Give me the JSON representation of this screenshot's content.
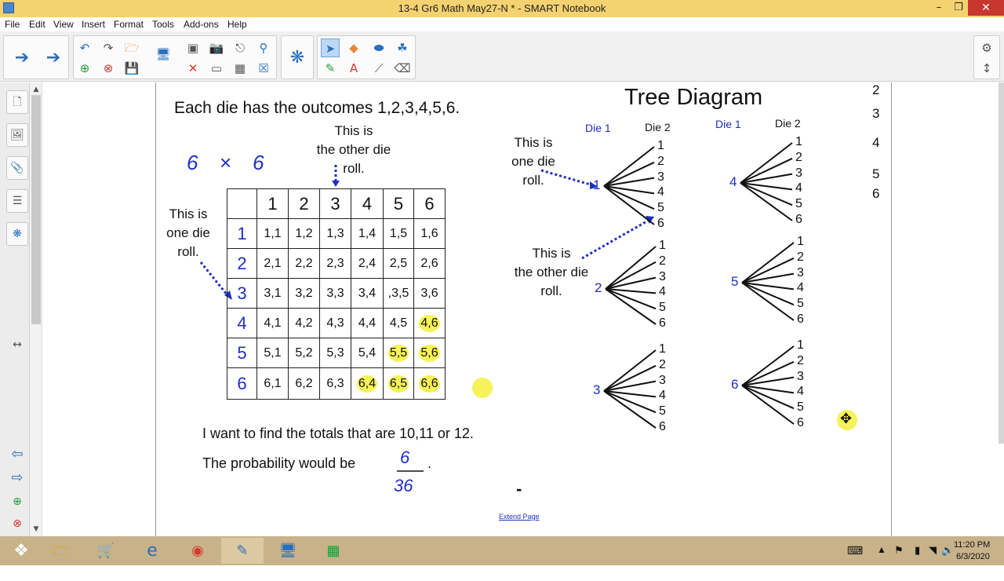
{
  "window": {
    "title": "13-4 Gr6 Math May27-N * - SMART Notebook"
  },
  "menu": [
    "File",
    "Edit",
    "View",
    "Insert",
    "Format",
    "Tools",
    "Add-ons",
    "Help"
  ],
  "page": {
    "outcomes_text": "Each die has the outcomes 1,2,3,4,5,6.",
    "other_die_label": [
      "This is",
      "the other die",
      "roll."
    ],
    "one_die_label": [
      "This is",
      "one die",
      "roll."
    ],
    "handwritten_6x6": "6 × 6",
    "grid": {
      "col_headers": [
        "1",
        "2",
        "3",
        "4",
        "5",
        "6"
      ],
      "rows": [
        {
          "head": "1",
          "cells": [
            "1,1",
            "1,2",
            "1,3",
            "1,4",
            "1,5",
            "1,6"
          ]
        },
        {
          "head": "2",
          "cells": [
            "2,1",
            "2,2",
            "2,3",
            "2,4",
            "2,5",
            "2,6"
          ]
        },
        {
          "head": "3",
          "cells": [
            "3,1",
            "3,2",
            "3,3",
            "3,4",
            ",3,5",
            "3,6"
          ]
        },
        {
          "head": "4",
          "cells": [
            "4,1",
            "4,2",
            "4,3",
            "4,4",
            "4,5",
            "4,6"
          ]
        },
        {
          "head": "5",
          "cells": [
            "5,1",
            "5,2",
            "5,3",
            "5,4",
            "5,5",
            "5,6"
          ]
        },
        {
          "head": "6",
          "cells": [
            "6,1",
            "6,2",
            "6,3",
            "6,4",
            "6,5",
            "6,6"
          ]
        }
      ],
      "highlighted": [
        "4,6",
        "5,5",
        "5,6",
        "6,4",
        "6,5",
        "6,6"
      ]
    },
    "totals_text": "I want to find the totals that are 10,11 or 12.",
    "probability_text": "The probability would be",
    "fraction_numerator": "6",
    "fraction_denominator": "36",
    "period": ".",
    "dash": "-",
    "extend_page": "Extend Page",
    "tree": {
      "title": "Tree Diagram",
      "die1_label": "Die 1",
      "die2_label": "Die 2",
      "branches": [
        "1",
        "2",
        "3",
        "4",
        "5",
        "6"
      ],
      "roots_left": [
        "1",
        "2",
        "3"
      ],
      "roots_right": [
        "4",
        "5",
        "6"
      ],
      "one_die_label": [
        "This is",
        "one die",
        "roll."
      ],
      "other_die_label": [
        "This is",
        "the other die",
        "roll."
      ]
    },
    "right_edge_numbers": [
      "2",
      "3",
      "4",
      "5",
      "6"
    ]
  },
  "taskbar": {
    "time": "11:20 PM",
    "date": "6/3/2020"
  }
}
